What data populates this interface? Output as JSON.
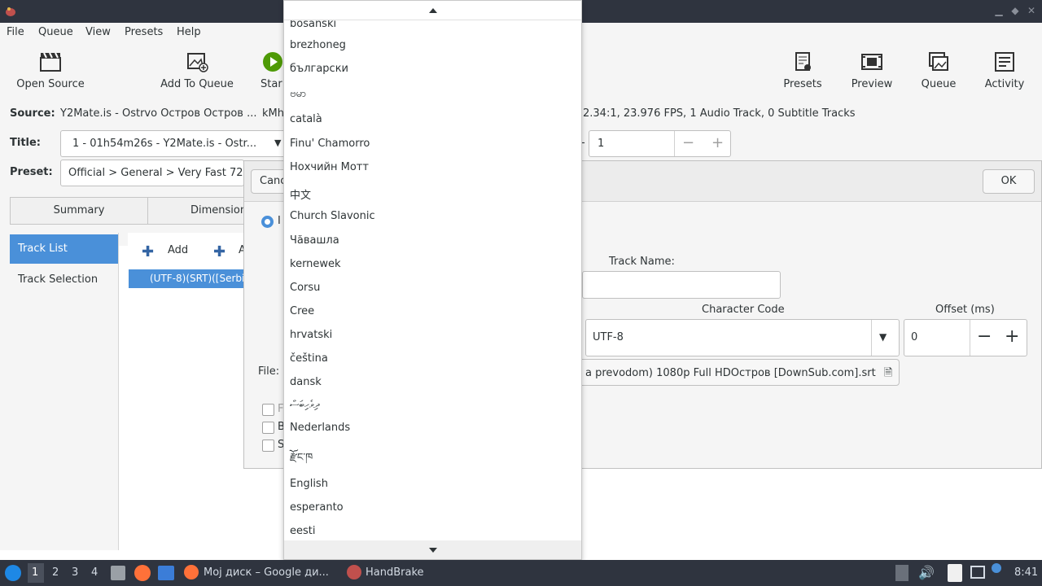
{
  "menubar": {
    "items": [
      "File",
      "Queue",
      "View",
      "Presets",
      "Help"
    ]
  },
  "toolbar": {
    "left": [
      {
        "label": "Open Source",
        "icon": "clapperboard-icon"
      },
      {
        "label": "Add To Queue",
        "icon": "image-add-icon"
      },
      {
        "label": "Star",
        "icon": "play-icon"
      }
    ],
    "right": [
      {
        "label": "Presets",
        "icon": "presets-icon"
      },
      {
        "label": "Preview",
        "icon": "film-icon"
      },
      {
        "label": "Queue",
        "icon": "images-icon"
      },
      {
        "label": "Activity",
        "icon": "activity-icon"
      }
    ]
  },
  "source": {
    "label": "Source:",
    "value_left": "Y2Mate.is - Ostrvo Остров Остров ...",
    "value_mid": "kMh",
    "value_right": "2.34:1, 23.976 FPS, 1 Audio Track, 0 Subtitle Tracks"
  },
  "title_row": {
    "label": "Title:",
    "value": "1 - 01h54m26s - Y2Mate.is - Ostr...",
    "dash": "-",
    "spin_value": "1",
    "minus": "−",
    "plus": "+"
  },
  "preset_row": {
    "label": "Preset:",
    "value": "Official > General > Very Fast 72"
  },
  "tabs": [
    "Summary",
    "Dimension"
  ],
  "sidebar": {
    "items": [
      "Track List",
      "Track Selection"
    ]
  },
  "track_list": {
    "add_label": "Add",
    "add2_label": "A",
    "row": "(UTF-8)(SRT)([Serbia"
  },
  "dialog": {
    "cancel": "Canc",
    "ok": "OK",
    "radio_label": "I",
    "track_name_label": "Track Name:",
    "char_code_label": "Character Code",
    "char_code_value": "UTF-8",
    "offset_label": "Offset (ms)",
    "offset_value": "0",
    "file_label": "File:",
    "file_value": "a prevodom) 1080p Full HDОстров [DownSub.com].srt",
    "checkbox_labels": [
      "F",
      "B",
      "S"
    ]
  },
  "languages": [
    "bosanski",
    "brezhoneg",
    "български",
    "ဗမာ",
    "català",
    "Finu' Chamorro",
    "Нохчийн Мотт",
    "中文",
    "Church Slavonic",
    "Чăвашла",
    "kernewek",
    "Corsu",
    "Cree",
    "hrvatski",
    "čeština",
    "dansk",
    "ދިވެހިބަސް",
    "Nederlands",
    "རྫོང་ཁ",
    "English",
    "esperanto",
    "eesti"
  ],
  "taskbar": {
    "workspaces": [
      "1",
      "2",
      "3",
      "4"
    ],
    "apps": [
      {
        "label": "Мој диск – Google ди..."
      },
      {
        "label": "HandBrake"
      }
    ],
    "clock": "8:41"
  },
  "colors": {
    "accent": "#4a90d9",
    "panel": "#2f343f"
  }
}
